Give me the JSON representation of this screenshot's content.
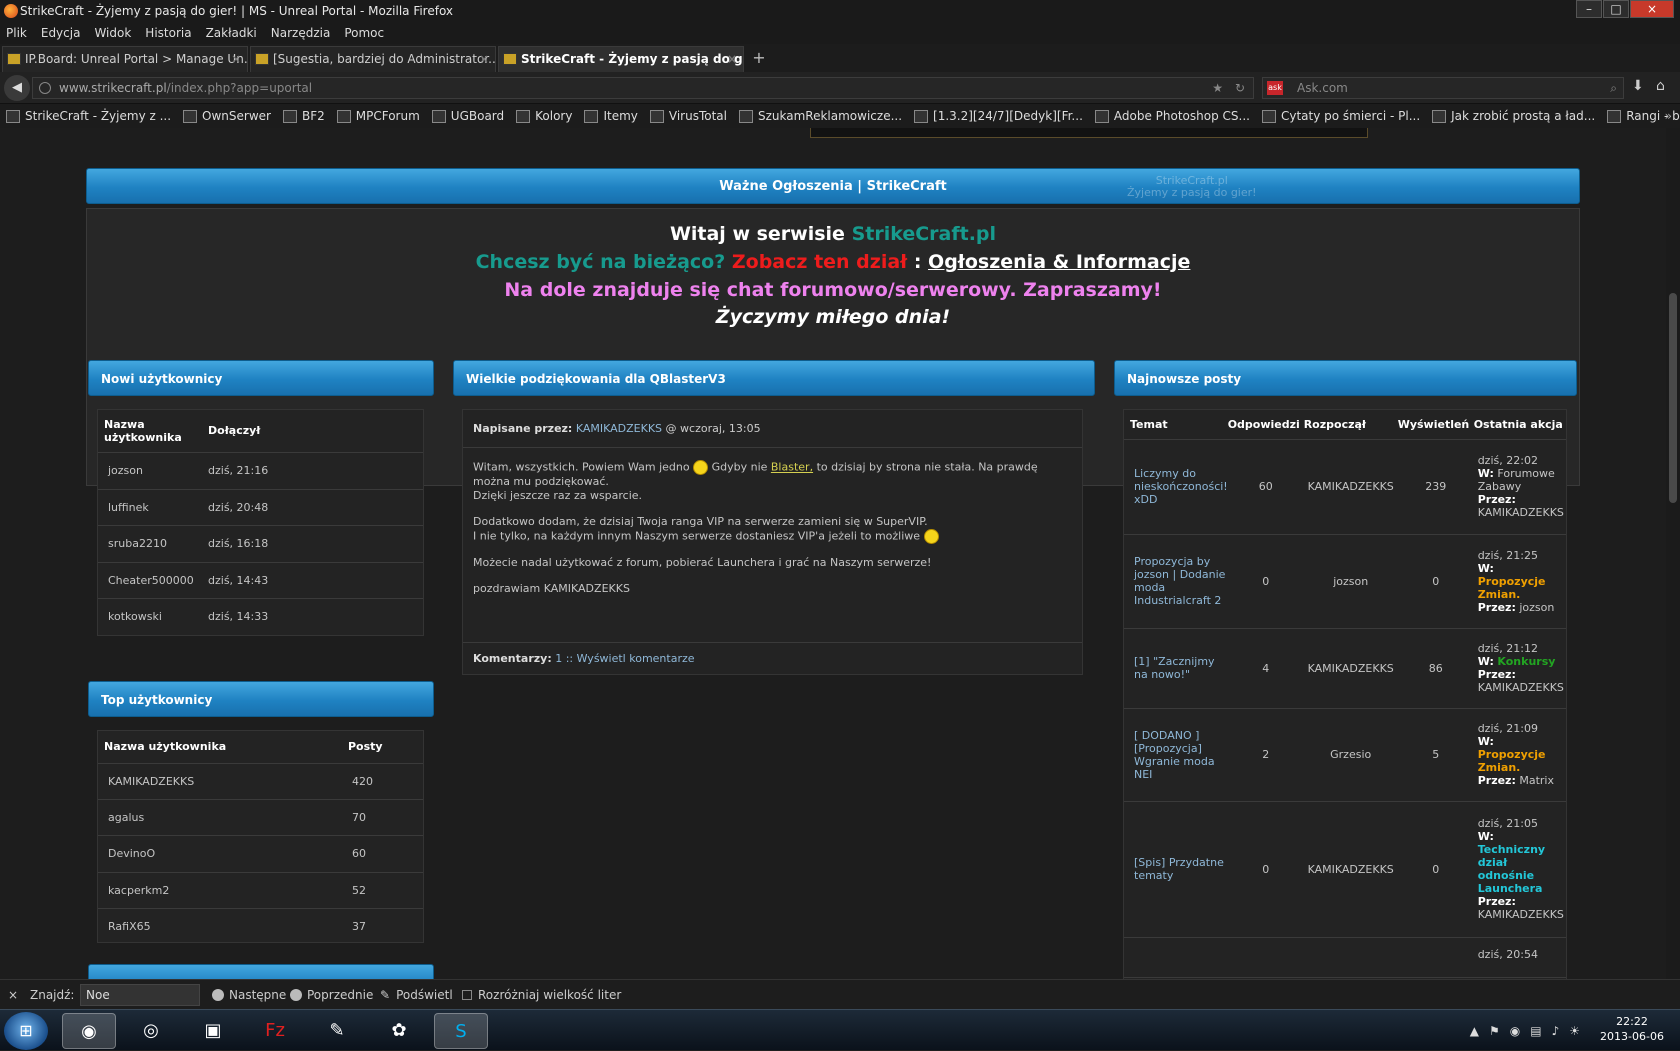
{
  "window": {
    "title": "StrikeCraft - Żyjemy z pasją do gier! | MS - Unreal Portal - Mozilla Firefox"
  },
  "menu": [
    "Plik",
    "Edycja",
    "Widok",
    "Historia",
    "Zakładki",
    "Narzędzia",
    "Pomoc"
  ],
  "tabs": [
    {
      "label": "IP.Board: Unreal Portal > Manage Un..."
    },
    {
      "label": "[Sugestia, bardziej do Administrator..."
    },
    {
      "label": "StrikeCraft - Żyjemy z pasją do gie..."
    }
  ],
  "nav": {
    "url_domain": "www.strikecraft.pl",
    "url_path": "/index.php?app=uportal",
    "search_placeholder": "Ask.com",
    "search_engine": "ask"
  },
  "bookmarks": [
    "StrikeCraft - Żyjemy z ...",
    "OwnSerwer",
    "BF2",
    "MPCForum",
    "UGBoard",
    "Kolory",
    "Itemy",
    "VirusTotal",
    "SzukamReklamowicze...",
    "[1.3.2][24/7][Dedyk][Fr...",
    "Adobe Photoshop CS...",
    "Cytaty po śmierci - Pl...",
    "Jak zrobić prostą a ład...",
    "Rangi - by Broniu - Gr..."
  ],
  "announcement": {
    "title": "Ważne Ogłoszenia | StrikeCraft",
    "watermark1": "StrikeCraft.pl",
    "watermark2": "Żyjemy z pasją do gier!"
  },
  "welcome": {
    "l1a": "Witaj w serwisie ",
    "l1b": "StrikeCraft.pl",
    "l2a": "Chcesz być na bieżąco? ",
    "l2b": "Zobacz ten dział",
    "l2c": " : ",
    "l2d": "Ogłoszenia & Informacje",
    "l3": "Na dole znajduje się chat forumowo/serwerowy. Zapraszamy!",
    "l4": "Życzymy miłego dnia!"
  },
  "new_users": {
    "title": "Nowi użytkownicy",
    "col_name": "Nazwa użytkownika",
    "col_joined": "Dołączył",
    "rows": [
      {
        "name": "jozson",
        "joined": "dziś, 21:16"
      },
      {
        "name": "luffinek",
        "joined": "dziś, 20:48"
      },
      {
        "name": "sruba2210",
        "joined": "dziś, 16:18"
      },
      {
        "name": "Cheater500000",
        "joined": "dziś, 14:43"
      },
      {
        "name": "kotkowski",
        "joined": "dziś, 14:33"
      }
    ]
  },
  "top_users": {
    "title": "Top użytkownicy",
    "col_name": "Nazwa użytkownika",
    "col_posts": "Posty",
    "rows": [
      {
        "name": "KAMIKADZEKKS",
        "posts": "420"
      },
      {
        "name": "agalus",
        "posts": "70"
      },
      {
        "name": "DevinoO",
        "posts": "60"
      },
      {
        "name": "kacperkm2",
        "posts": "52"
      },
      {
        "name": "RafiX65",
        "posts": "37"
      }
    ]
  },
  "news": {
    "title": "Wielkie podziękowania dla QBlasterV3",
    "written_by_label": "Napisane przez:",
    "author": "KAMIKADZEKKS",
    "date": "@ wczoraj, 13:05",
    "p1a": "Witam, wszystkich. Powiem Wam jedno ",
    "p1b": " Gdyby nie ",
    "p1link": "Blaster,",
    "p1c": " to dzisiaj by strona nie stała. Na prawdę można mu podziękować.",
    "p1d": "Dzięki jeszcze raz za wsparcie.",
    "p2a": "Dodatkowo dodam, że dzisiaj Twoja ranga VIP na serwerze zamieni się w SuperVIP.",
    "p2b": "I nie tylko, na każdym innym Naszym serwerze dostaniesz VIP'a jeżeli to możliwe ",
    "p3": "Możecie nadal użytkować z forum, pobierać Launchera i grać na Naszym serwerze!",
    "p4": "pozdrawiam KAMIKADZEKKS",
    "comments_label": "Komentarzy:",
    "comments_value": "1 :: Wyświetl komentarze"
  },
  "latest_posts": {
    "title": "Najnowsze posty",
    "cols": [
      "Temat",
      "Odpowiedzi",
      "Rozpoczął",
      "Wyświetleń",
      "Ostatnia akcja"
    ],
    "rows": [
      {
        "topic": "Liczymy do nieskończoności! xDD",
        "replies": "60",
        "starter": "KAMIKADZEKKS",
        "views": "239",
        "time": "dziś, 22:02",
        "w_label": "W:",
        "forum": "Forumowe Zabawy",
        "by_label": "Przez:",
        "by": "KAMIKADZEKKS"
      },
      {
        "topic": "Propozycja by jozson | Dodanie moda Industrialcraft 2",
        "replies": "0",
        "starter": "jozson",
        "views": "0",
        "time": "dziś, 21:25",
        "w_label": "W:",
        "forum": "Propozycje Zmian.",
        "by_label": "Przez:",
        "by": "jozson"
      },
      {
        "topic": "[1] \"Zacznijmy na nowo!\"",
        "replies": "4",
        "starter": "KAMIKADZEKKS",
        "views": "86",
        "time": "dziś, 21:12",
        "w_label": "W:",
        "forum": "Konkursy",
        "by_label": "Przez:",
        "by": "KAMIKADZEKKS"
      },
      {
        "topic": "[ DODANO ] [Propozycja] Wgranie moda NEI",
        "replies": "2",
        "starter": "Grzesio",
        "views": "5",
        "time": "dziś, 21:09",
        "w_label": "W:",
        "forum": "Propozycje Zmian.",
        "by_label": "Przez:",
        "by": "Matrix"
      },
      {
        "topic": "[Spis] Przydatne tematy",
        "replies": "0",
        "starter": "KAMIKADZEKKS",
        "views": "0",
        "time": "dziś, 21:05",
        "w_label": "W:",
        "forum": "Techniczny dział odnośnie Launchera",
        "by_label": "Przez:",
        "by": "KAMIKADZEKKS"
      },
      {
        "topic": "",
        "replies": "",
        "starter": "",
        "views": "",
        "time": "dziś, 20:54",
        "w_label": "",
        "forum": "",
        "by_label": "",
        "by": ""
      }
    ]
  },
  "findbar": {
    "close": "×",
    "label": "Znajdź:",
    "value": "Noe",
    "next": "Następne",
    "prev": "Poprzednie",
    "highlight": "Podświetl",
    "match_case": "Rozróżniaj wielkość liter"
  },
  "taskbar": {
    "time": "22:22",
    "date": "2013-06-06"
  },
  "colors": {
    "accent": "#2a8fd0",
    "teal": "#179b8e",
    "red": "#ee1c1c",
    "pink": "#ee82ee",
    "orange": "#f0a000",
    "green": "#22a522",
    "cyan": "#23c7d8"
  }
}
